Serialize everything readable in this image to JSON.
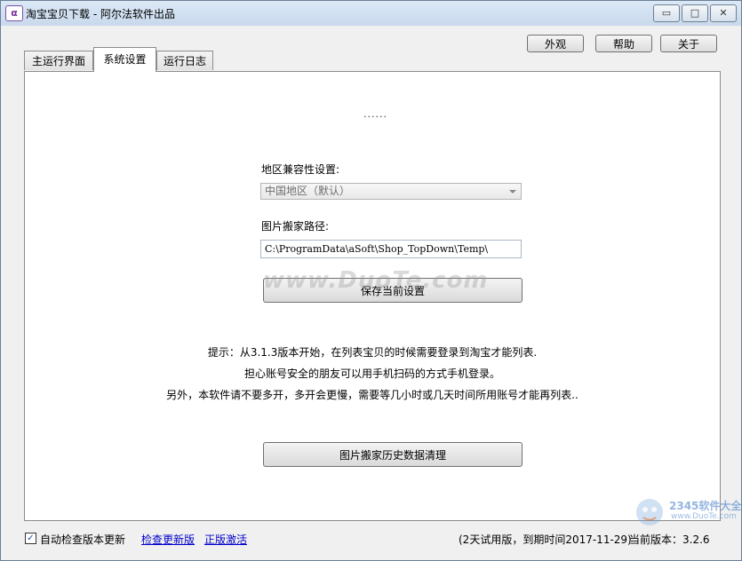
{
  "window": {
    "title": "淘宝宝贝下载 - 阿尔法软件出品",
    "app_icon_glyph": "α",
    "controls": {
      "minimize": "▭",
      "maximize": "□",
      "close": "✕"
    }
  },
  "toolbar": {
    "appearance": "外观",
    "help": "帮助",
    "about": "关于"
  },
  "tabs": [
    {
      "label": "主运行界面",
      "active": false
    },
    {
      "label": "系统设置",
      "active": true
    },
    {
      "label": "运行日志",
      "active": false
    }
  ],
  "settings": {
    "dots": "......",
    "region_label": "地区兼容性设置:",
    "region_value": "中国地区（默认）",
    "path_label": "图片搬家路径:",
    "path_value": "C:\\ProgramData\\aSoft\\Shop_TopDown\\Temp\\",
    "save_button": "保存当前设置",
    "watermark": "www.DuoTe.com",
    "tips": [
      "提示：从3.1.3版本开始，在列表宝贝的时候需要登录到淘宝才能列表.",
      "担心账号安全的朋友可以用手机扫码的方式手机登录。",
      "另外，本软件请不要多开，多开会更慢，需要等几小时或几天时间所用账号才能再列表.."
    ],
    "clean_button": "图片搬家历史数据清理"
  },
  "statusbar": {
    "auto_check_checked": true,
    "auto_check_label": "自动检查版本更新",
    "check_update_link": "检查更新版",
    "activate_link": "正版激活",
    "trial_text": "(2天试用版，到期时间2017-11-29)",
    "version_text": "当前版本：3.2.6"
  },
  "stamp": {
    "brand": "2345软件大全",
    "url": "www.DuoTe.com"
  },
  "colors": {
    "link": "#0000cc",
    "titlebar": "#c8d9ec"
  }
}
